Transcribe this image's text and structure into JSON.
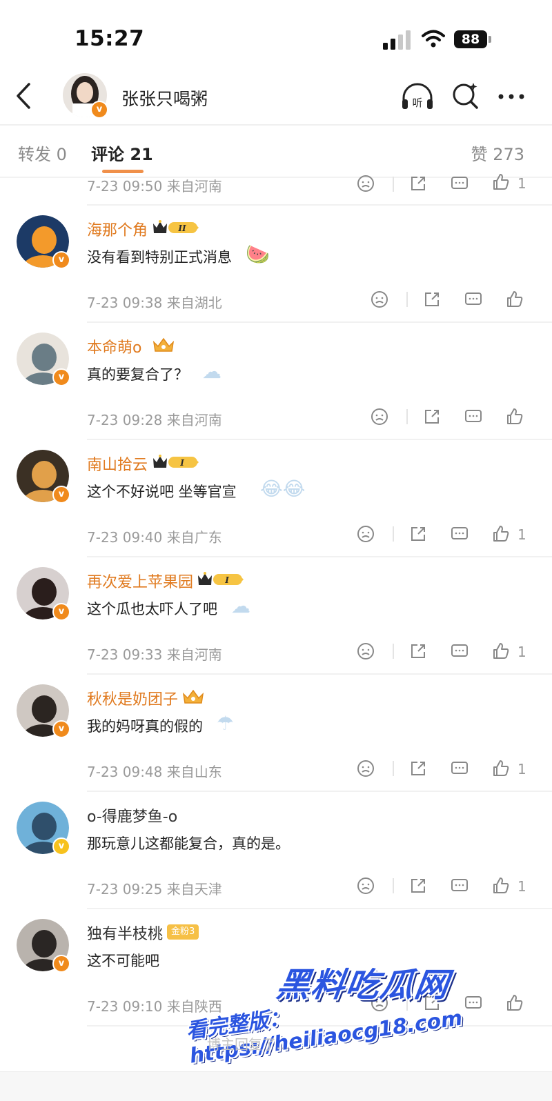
{
  "status_bar": {
    "time": "15:27",
    "battery": "88"
  },
  "header": {
    "author_name": "张张只喝粥"
  },
  "tabs": {
    "repost_label": "转发",
    "repost_count": "0",
    "comments_label": "评论",
    "comments_count": "21",
    "likes_label": "赞",
    "likes_count": "273"
  },
  "partial_row": {
    "meta": "7-23 09:50 来自河南",
    "likes": "1"
  },
  "comments": [
    {
      "name": "海那个角",
      "level": "II",
      "text": "没有看到特别正式消息",
      "meta": "7-23 09:38 来自湖北",
      "likes": ""
    },
    {
      "name": "本命萌o",
      "level": "",
      "text": "真的要复合了？",
      "meta": "7-23 09:28 来自河南",
      "likes": ""
    },
    {
      "name": "南山拾云",
      "level": "I",
      "text": "这个不好说吧 坐等官宣",
      "meta": "7-23 09:40 来自广东",
      "likes": "1"
    },
    {
      "name": "再次爱上苹果园",
      "level": "I",
      "text": "这个瓜也太吓人了吧",
      "meta": "7-23 09:33 来自河南",
      "likes": "1"
    },
    {
      "name": "秋秋是奶团子",
      "level": "",
      "text": "我的妈呀真的假的",
      "meta": "7-23 09:48 来自山东",
      "likes": "1"
    },
    {
      "name": "o-得鹿梦鱼-o",
      "level": "",
      "text": "那玩意儿这都能复合，真的是。",
      "meta": "7-23 09:25 来自天津",
      "likes": "1"
    },
    {
      "name": "独有半枝桃",
      "fan_badge": "金粉3",
      "text": "这不可能吧",
      "meta": "7-23 09:10 来自陕西",
      "likes": ""
    }
  ],
  "watermark": {
    "title": "黑料吃瓜网",
    "url": "看完整版：https://heiliaocg18.com"
  },
  "bottom_hint": "博主回复了…",
  "colors": {
    "accent": "#f0904a",
    "vip_name": "#e07a1f",
    "watermark": "#2b55e0"
  }
}
